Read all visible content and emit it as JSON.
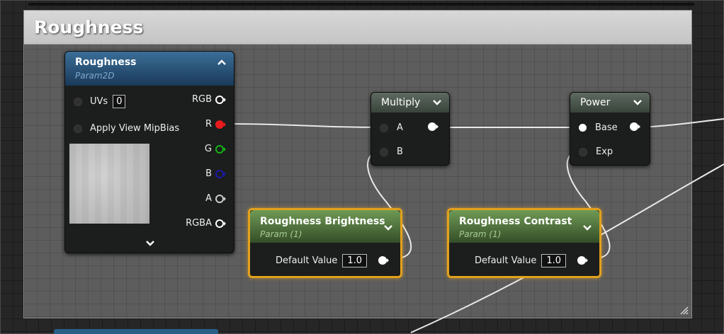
{
  "comment": {
    "title": "Roughness"
  },
  "texture_node": {
    "title": "Roughness",
    "subtitle": "Param2D",
    "inputs": [
      {
        "label": "UVs",
        "value": "0"
      },
      {
        "label": "Apply View MipBias"
      }
    ],
    "outputs": [
      "RGB",
      "R",
      "G",
      "B",
      "A",
      "RGBA"
    ]
  },
  "multiply_node": {
    "title": "Multiply",
    "inputs": [
      "A",
      "B"
    ]
  },
  "power_node": {
    "title": "Power",
    "inputs": [
      "Base",
      "Exp"
    ]
  },
  "brightness_node": {
    "title": "Roughness Brightness",
    "subtitle": "Param (1)",
    "field_label": "Default Value",
    "field_value": "1.0"
  },
  "contrast_node": {
    "title": "Roughness Contrast",
    "subtitle": "Param (1)",
    "field_label": "Default Value",
    "field_value": "1.0"
  },
  "colors": {
    "pin_r": "#e81c1c",
    "pin_g": "#14b414",
    "pin_b": "#1a1aa8",
    "selection": "#e3a11d",
    "texture_header": "#2c5a82",
    "param_header": "#5a7f44"
  }
}
